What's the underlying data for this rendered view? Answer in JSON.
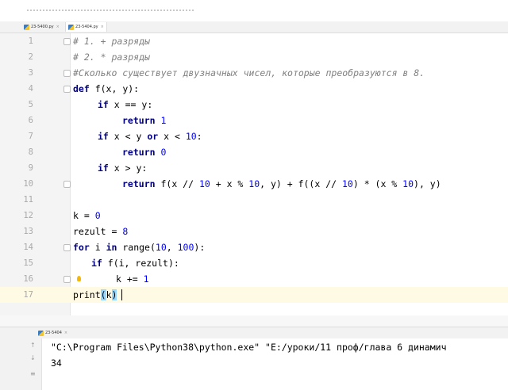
{
  "tabs": [
    {
      "label": "23-5400.py",
      "close": "×"
    },
    {
      "label": "23-5404.py",
      "close": "×"
    }
  ],
  "editor": {
    "lines": [
      {
        "n": "1",
        "text": "# 1. + разряды"
      },
      {
        "n": "2",
        "text": "# 2. * разряды"
      },
      {
        "n": "3",
        "text": "#Сколько существует двузначных чисел, которые преобразуются в 8."
      },
      {
        "n": "4",
        "text": "def f(x, y):"
      },
      {
        "n": "5",
        "text": "if x == y:"
      },
      {
        "n": "6",
        "text": "return 1"
      },
      {
        "n": "7",
        "text": "if x < y or x < 10:"
      },
      {
        "n": "8",
        "text": "return 0"
      },
      {
        "n": "9",
        "text": "if x > y:"
      },
      {
        "n": "10",
        "text": "return f(x // 10 + x % 10, y) + f((x // 10) * (x % 10), y)"
      },
      {
        "n": "11",
        "text": ""
      },
      {
        "n": "12",
        "text": "k = 0"
      },
      {
        "n": "13",
        "text": "rezult = 8"
      },
      {
        "n": "14",
        "text": "for i in range(10, 100):"
      },
      {
        "n": "15",
        "text": "if f(i, rezult):"
      },
      {
        "n": "16",
        "text": "k += 1"
      },
      {
        "n": "17",
        "text": "print(k)"
      }
    ]
  },
  "run": {
    "tab_label": "23-5404",
    "tab_close": "×",
    "command": "\"C:\\Program Files\\Python38\\python.exe\" \"E:/уроки/11 проф/глава 6 динамич",
    "output": "34",
    "tools": [
      "↑",
      "↓",
      "≡"
    ]
  }
}
